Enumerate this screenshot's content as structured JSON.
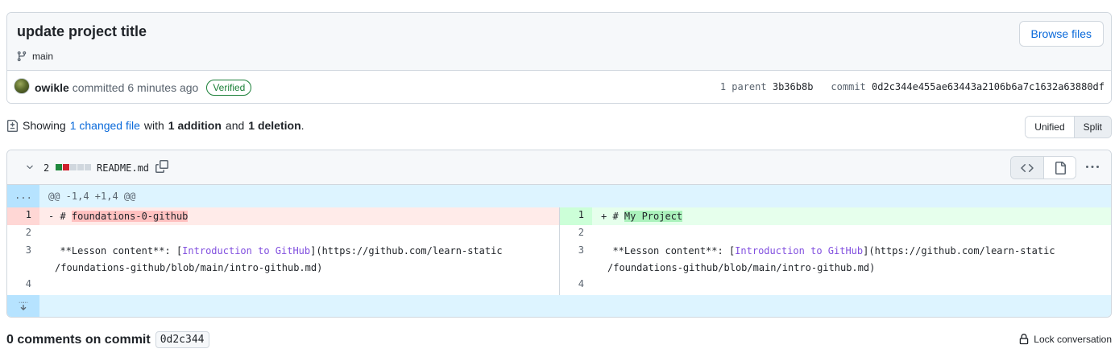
{
  "commit": {
    "title": "update project title",
    "branch": "main",
    "browse_label": "Browse files",
    "author": "owikle",
    "action": "committed",
    "time": "6 minutes ago",
    "verified": "Verified",
    "parent_label": "1 parent",
    "parent_sha": "3b36b8b",
    "commit_label": "commit",
    "sha": "0d2c344e455ae63443a2106b6a7c1632a63880df"
  },
  "summary": {
    "showing": "Showing",
    "changed": "1 changed file",
    "with": "with",
    "additions": "1 addition",
    "and": "and",
    "deletions": "1 deletion",
    "period": "."
  },
  "view_toggle": {
    "unified": "Unified",
    "split": "Split",
    "active": "Split"
  },
  "file": {
    "change_count": "2",
    "name": "README.md",
    "diff_blocks": [
      "#1f883d",
      "#cf222e",
      "#d0d7de",
      "#d0d7de",
      "#d0d7de"
    ]
  },
  "hunk": {
    "marker": "...",
    "header": "@@ -1,4 +1,4 @@"
  },
  "left": {
    "lines": [
      {
        "num": "1",
        "prefix": "- # ",
        "text": "foundations-0-github"
      },
      {
        "num": "2"
      },
      {
        "num": "3",
        "pre": "  **Lesson content**: [",
        "link": "Introduction to GitHub",
        "post": "](https://github.com/learn-static",
        "cont": "/foundations-github/blob/main/intro-github.md)"
      },
      {
        "num": "4"
      }
    ]
  },
  "right": {
    "lines": [
      {
        "num": "1",
        "prefix": "+ # ",
        "text": "My Project"
      },
      {
        "num": "2"
      },
      {
        "num": "3",
        "pre": "  **Lesson content**: [",
        "link": "Introduction to GitHub",
        "post": "](https://github.com/learn-static",
        "cont": "/foundations-github/blob/main/intro-github.md)"
      },
      {
        "num": "4"
      }
    ]
  },
  "comments": {
    "title": "0 comments on commit",
    "sha": "0d2c344",
    "lock": "Lock conversation"
  }
}
